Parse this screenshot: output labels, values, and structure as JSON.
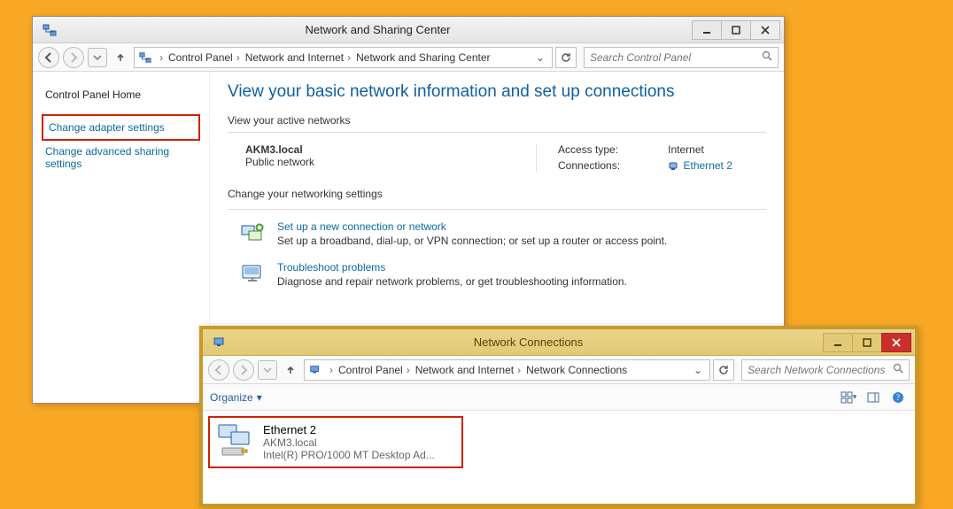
{
  "win1": {
    "title": "Network and Sharing Center",
    "crumbs": [
      "Control Panel",
      "Network and Internet",
      "Network and Sharing Center"
    ],
    "search_placeholder": "Search Control Panel",
    "sidebar": {
      "home": "Control Panel Home",
      "adapter": "Change adapter settings",
      "advanced": "Change advanced sharing settings"
    },
    "heading": "View your basic network information and set up connections",
    "active_nets_label": "View your active networks",
    "network": {
      "name": "AKM3.local",
      "type": "Public network",
      "access_label": "Access type:",
      "access_value": "Internet",
      "conn_label": "Connections:",
      "conn_value": "Ethernet 2"
    },
    "change_label": "Change your networking settings",
    "setup": {
      "title": "Set up a new connection or network",
      "desc": "Set up a broadband, dial-up, or VPN connection; or set up a router or access point."
    },
    "tshoot": {
      "title": "Troubleshoot problems",
      "desc": "Diagnose and repair network problems, or get troubleshooting information."
    }
  },
  "win2": {
    "title": "Network Connections",
    "crumbs": [
      "Control Panel",
      "Network and Internet",
      "Network Connections"
    ],
    "search_placeholder": "Search Network Connections",
    "organize": "Organize",
    "adapter": {
      "name": "Ethernet 2",
      "domain": "AKM3.local",
      "device": "Intel(R) PRO/1000 MT Desktop Ad..."
    }
  }
}
